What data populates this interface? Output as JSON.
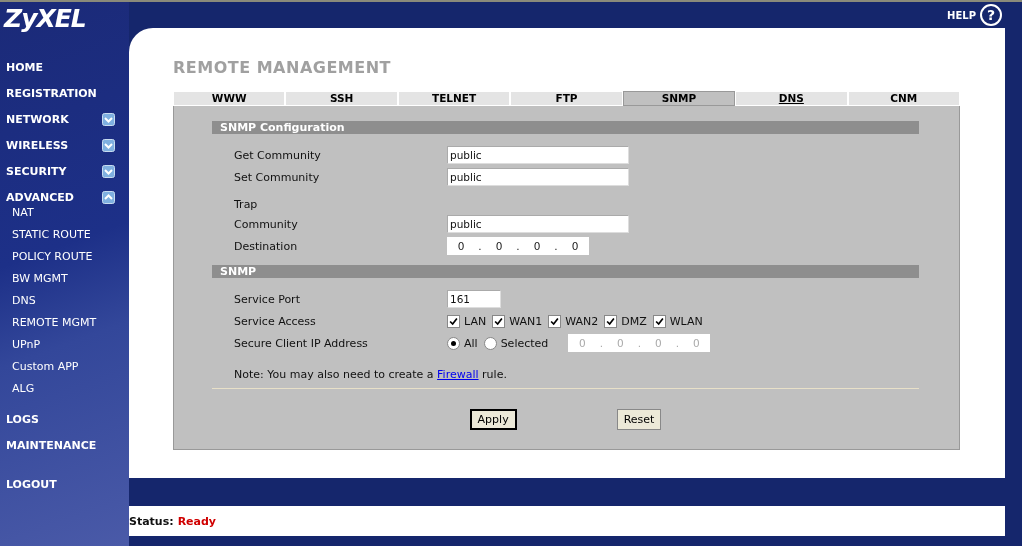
{
  "brand": "ZyXEL",
  "help": {
    "label": "HELP",
    "icon": "?"
  },
  "sidebar": {
    "items": [
      {
        "label": "HOME",
        "kind": "link"
      },
      {
        "label": "REGISTRATION",
        "kind": "link"
      },
      {
        "label": "NETWORK",
        "kind": "group",
        "expanded": false
      },
      {
        "label": "WIRELESS",
        "kind": "group",
        "expanded": false
      },
      {
        "label": "SECURITY",
        "kind": "group",
        "expanded": false
      },
      {
        "label": "ADVANCED",
        "kind": "group",
        "expanded": true,
        "children": [
          {
            "label": "NAT"
          },
          {
            "label": "STATIC ROUTE"
          },
          {
            "label": "POLICY ROUTE"
          },
          {
            "label": "BW MGMT"
          },
          {
            "label": "DNS"
          },
          {
            "label": "REMOTE MGMT"
          },
          {
            "label": "UPnP"
          },
          {
            "label": "Custom APP"
          },
          {
            "label": "ALG"
          }
        ]
      },
      {
        "label": "LOGS",
        "kind": "link"
      },
      {
        "label": "MAINTENANCE",
        "kind": "link"
      },
      {
        "label": "LOGOUT",
        "kind": "logout"
      }
    ]
  },
  "page_title": "REMOTE MANAGEMENT",
  "tabs": [
    {
      "label": "WWW",
      "selected": false,
      "underlined": false
    },
    {
      "label": "SSH",
      "selected": false,
      "underlined": false
    },
    {
      "label": "TELNET",
      "selected": false,
      "underlined": false
    },
    {
      "label": "FTP",
      "selected": false,
      "underlined": false
    },
    {
      "label": "SNMP",
      "selected": true,
      "underlined": false
    },
    {
      "label": "DNS",
      "selected": false,
      "underlined": true
    },
    {
      "label": "CNM",
      "selected": false,
      "underlined": false
    }
  ],
  "sections": [
    {
      "title": "SNMP Configuration",
      "rows": [
        {
          "kind": "text",
          "label": "Get Community",
          "value": "public"
        },
        {
          "kind": "text",
          "label": "Set Community",
          "value": "public"
        },
        {
          "kind": "heading",
          "label": "Trap"
        },
        {
          "kind": "text",
          "label": "Community",
          "value": "public"
        },
        {
          "kind": "ip",
          "label": "Destination",
          "octets": [
            "0",
            "0",
            "0",
            "0"
          ],
          "separator": ".",
          "disabled": false
        }
      ]
    },
    {
      "title": "SNMP",
      "rows": [
        {
          "kind": "port",
          "label": "Service Port",
          "value": "161"
        },
        {
          "kind": "checks",
          "label": "Service Access",
          "options": [
            {
              "label": "LAN",
              "checked": true
            },
            {
              "label": "WAN1",
              "checked": true
            },
            {
              "label": "WAN2",
              "checked": true
            },
            {
              "label": "DMZ",
              "checked": true
            },
            {
              "label": "WLAN",
              "checked": true
            }
          ]
        },
        {
          "kind": "radios",
          "label": "Secure Client IP Address",
          "options": [
            {
              "label": "All",
              "selected": true
            },
            {
              "label": "Selected",
              "selected": false
            }
          ],
          "octets": [
            "0",
            "0",
            "0",
            "0"
          ],
          "separator": ".",
          "disabled": true
        }
      ]
    }
  ],
  "note": {
    "before": "Note: You may also need to create a",
    "link": "Firewall",
    "after": "rule."
  },
  "buttons": [
    {
      "label": "Apply",
      "focused": true
    },
    {
      "label": "Reset",
      "focused": false
    }
  ],
  "status": {
    "label": "Status:",
    "value": "Ready"
  }
}
